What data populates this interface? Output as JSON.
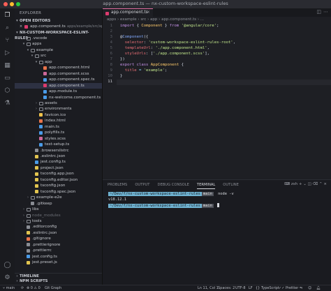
{
  "window": {
    "title": "app.component.ts — nx-custom-workspace-eslint-rules"
  },
  "sidebar": {
    "title": "EXPLORER",
    "open_editors_label": "OPEN EDITORS",
    "open_editor_item": {
      "name": "app.component.ts",
      "path": "apps/example/src/app"
    },
    "project_label": "NX-CUSTOM-WORKSPACE-ESLINT-RULES",
    "tree": [
      {
        "label": ".vscode",
        "depth": 1,
        "kind": "folder",
        "open": false
      },
      {
        "label": "apps",
        "depth": 1,
        "kind": "folder",
        "open": true
      },
      {
        "label": "example",
        "depth": 2,
        "kind": "folder",
        "open": true
      },
      {
        "label": "src",
        "depth": 3,
        "kind": "folder",
        "open": true
      },
      {
        "label": "app",
        "depth": 4,
        "kind": "folder",
        "open": true
      },
      {
        "label": "app.component.html",
        "depth": 5,
        "kind": "html"
      },
      {
        "label": "app.component.scss",
        "depth": 5,
        "kind": "scss"
      },
      {
        "label": "app.component.spec.ts",
        "depth": 5,
        "kind": "ts"
      },
      {
        "label": "app.component.ts",
        "depth": 5,
        "kind": "ang",
        "selected": true
      },
      {
        "label": "app.module.ts",
        "depth": 5,
        "kind": "ts"
      },
      {
        "label": "nx-welcome.component.ts",
        "depth": 5,
        "kind": "ts"
      },
      {
        "label": "assets",
        "depth": 4,
        "kind": "folder",
        "open": false
      },
      {
        "label": "environments",
        "depth": 4,
        "kind": "folder",
        "open": false
      },
      {
        "label": "favicon.ico",
        "depth": 4,
        "kind": "ico"
      },
      {
        "label": "index.html",
        "depth": 4,
        "kind": "html"
      },
      {
        "label": "main.ts",
        "depth": 4,
        "kind": "ts"
      },
      {
        "label": "polyfills.ts",
        "depth": 4,
        "kind": "ts"
      },
      {
        "label": "styles.scss",
        "depth": 4,
        "kind": "scss"
      },
      {
        "label": "test-setup.ts",
        "depth": 4,
        "kind": "ts"
      },
      {
        "label": ".browserslistrc",
        "depth": 3,
        "kind": "cfg"
      },
      {
        "label": ".eslintrc.json",
        "depth": 3,
        "kind": "json"
      },
      {
        "label": "jest.config.ts",
        "depth": 3,
        "kind": "ts"
      },
      {
        "label": "project.json",
        "depth": 3,
        "kind": "json"
      },
      {
        "label": "tsconfig.app.json",
        "depth": 3,
        "kind": "json"
      },
      {
        "label": "tsconfig.editor.json",
        "depth": 3,
        "kind": "json"
      },
      {
        "label": "tsconfig.json",
        "depth": 3,
        "kind": "json"
      },
      {
        "label": "tsconfig.spec.json",
        "depth": 3,
        "kind": "json"
      },
      {
        "label": "example-e2e",
        "depth": 2,
        "kind": "folder",
        "open": false
      },
      {
        "label": ".gitkeep",
        "depth": 2,
        "kind": "cfg"
      },
      {
        "label": "libs",
        "depth": 1,
        "kind": "folder",
        "open": false
      },
      {
        "label": "node_modules",
        "depth": 1,
        "kind": "folder",
        "open": false,
        "dim": true
      },
      {
        "label": "tools",
        "depth": 1,
        "kind": "folder",
        "open": false
      },
      {
        "label": ".editorconfig",
        "depth": 1,
        "kind": "cfg"
      },
      {
        "label": ".eslintrc.json",
        "depth": 1,
        "kind": "json"
      },
      {
        "label": ".gitignore",
        "depth": 1,
        "kind": "git"
      },
      {
        "label": ".prettierignore",
        "depth": 1,
        "kind": "cfg"
      },
      {
        "label": ".prettierrc",
        "depth": 1,
        "kind": "cfg"
      },
      {
        "label": "jest.config.ts",
        "depth": 1,
        "kind": "ts"
      },
      {
        "label": "jest.preset.js",
        "depth": 1,
        "kind": "js"
      }
    ],
    "timeline_label": "TIMELINE",
    "npm_scripts_label": "NPM SCRIPTS"
  },
  "editor": {
    "tab_label": "app.component.ts",
    "breadcrumb": [
      "apps",
      "example",
      "src",
      "app",
      "app.component.ts",
      "..."
    ],
    "line_numbers": [
      "1",
      "2",
      "3",
      "4",
      "5",
      "6",
      "7",
      "8",
      "9",
      "10",
      "11"
    ],
    "code": {
      "l1": [
        "import",
        " { ",
        "Component",
        " } ",
        "from",
        " '@angular/core'",
        ";"
      ],
      "l3": [
        "@",
        "Component",
        "({"
      ],
      "l4": [
        "  selector",
        ": ",
        "'custom-workspace-eslint-rules-root'",
        ","
      ],
      "l5": [
        "  templateUrl",
        ": ",
        "'./app.component.html'",
        ","
      ],
      "l6": [
        "  styleUrls",
        ": [",
        "'./app.component.scss'",
        "],"
      ],
      "l7": [
        "})"
      ],
      "l8": [
        "export",
        " class ",
        "AppComponent",
        " {"
      ],
      "l9": [
        "  title",
        " = ",
        "'example'",
        ";"
      ],
      "l10": [
        "}"
      ]
    },
    "active_line": "11"
  },
  "panel": {
    "tabs": [
      "PROBLEMS",
      "OUTPUT",
      "DEBUG CONSOLE",
      "TERMINAL",
      "OUTLINE"
    ],
    "active_tab": "TERMINAL",
    "shell_label": "zsh",
    "terminal": {
      "prompt_path": "~/Dev/f/nx-custom-workspace-eslint-rules",
      "branch": "main",
      "command": "node -v",
      "output": "v18.12.1"
    }
  },
  "statusbar": {
    "branch": "main",
    "git_graph": "Git Graph",
    "position": "Ln 11, Col 1",
    "spaces": "Spaces: 2",
    "encoding": "UTF-8",
    "eol": "LF",
    "language": "TypeScript",
    "prettier": "Prettier"
  },
  "colors": {
    "accent": "#e06c9f",
    "prompt_bg": "#6fb3d2",
    "branch_bg": "#4c4f57"
  }
}
